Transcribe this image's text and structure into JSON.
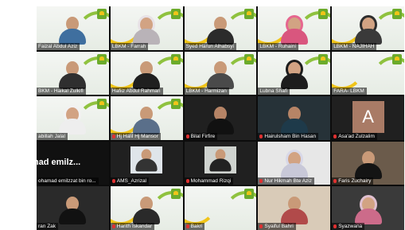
{
  "participants": [
    {
      "name": "Faizal Abdul Aziz",
      "muted": false
    },
    {
      "name": "LBKM - Farrah",
      "muted": false
    },
    {
      "name": "Syed Harun Alhabsyi",
      "muted": false
    },
    {
      "name": "LBKM - Ruhaini",
      "muted": false
    },
    {
      "name": "LBKM - NAJIHAH",
      "muted": false
    },
    {
      "name": "BKM - Haikal Zulkifl",
      "muted": false
    },
    {
      "name": "Hafiiz Abdul Rahman",
      "muted": false
    },
    {
      "name": "LBKM - Harmizan",
      "muted": false
    },
    {
      "name": "Lubna Shafi",
      "muted": false
    },
    {
      "name": "FARA- LBKM",
      "muted": false
    },
    {
      "name": "abillah Jalal",
      "muted": false
    },
    {
      "name": "Hj Halil Hj Mansor",
      "muted": true
    },
    {
      "name": "Bilal Firfire",
      "muted": true
    },
    {
      "name": "Hairulsham Bin Hasan",
      "muted": true
    },
    {
      "name": "Asa'ad Zulzalim",
      "muted": true
    },
    {
      "name": "ohamad emilzzat bin ro...",
      "muted": false
    },
    {
      "name": "AMS_Azrizal",
      "muted": true
    },
    {
      "name": "Mohammad Rizqi",
      "muted": true
    },
    {
      "name": "Nur Hikmah Bte Aziz",
      "muted": true
    },
    {
      "name": "Faris Zuchairy",
      "muted": true
    },
    {
      "name": "ran Zak",
      "muted": false
    },
    {
      "name": "Harith Iskandar",
      "muted": true
    },
    {
      "name": "Bakri",
      "muted": true
    },
    {
      "name": "Syaiful Bahri",
      "muted": true
    },
    {
      "name": "Syazwana",
      "muted": true
    }
  ],
  "tile_texts": {
    "avatar_initial": "A",
    "shared_name_large": "hamad emilz..."
  },
  "colors": {
    "brand_green": "#8fc23f",
    "brand_yellow": "#f0c419",
    "mute_red": "#e03131",
    "avatar_bg": "#a97b66"
  }
}
